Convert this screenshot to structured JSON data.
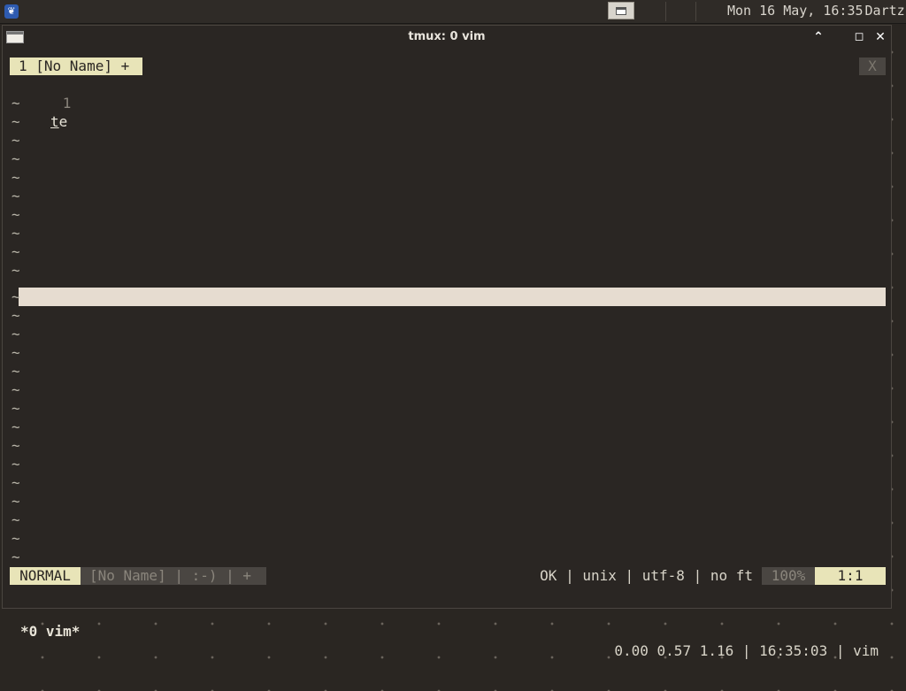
{
  "topbar": {
    "menu_glyph": "❦",
    "clock": "Mon 16 May, 16:35",
    "user": "Dartz"
  },
  "window": {
    "title": "tmux: 0 vim",
    "buttons": {
      "minimize": "⌃",
      "maximize": "◻",
      "close": "✕"
    }
  },
  "vim": {
    "tab_label": "1 [No Name] +",
    "tab_close": "X",
    "line_number": "1",
    "line_text_underlined": "t",
    "line_text_rest": "e",
    "tilde": "~",
    "status": {
      "mode": "NORMAL",
      "file_info": "[No Name] | :-) | +",
      "encoding_info": "OK | unix | utf-8 | no ft",
      "percent": "100%",
      "position": "1:1"
    }
  },
  "tmux": {
    "window_label": "*0 vim*",
    "right_status": "0.00 0.57 1.16 | 16:35:03 | vim"
  }
}
